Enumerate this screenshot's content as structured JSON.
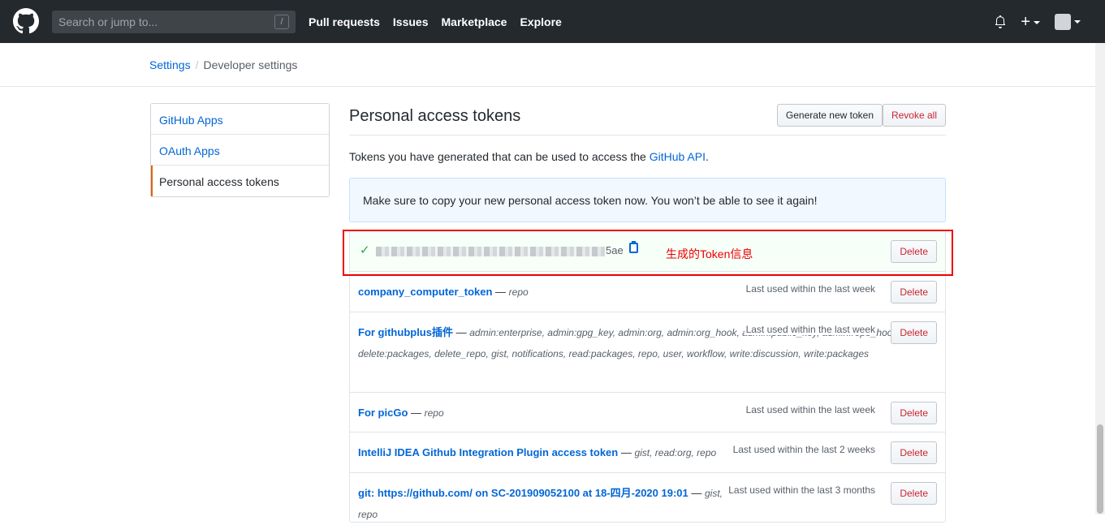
{
  "header": {
    "search_placeholder": "Search or jump to...",
    "search_shortcut": "/",
    "nav": [
      "Pull requests",
      "Issues",
      "Marketplace",
      "Explore"
    ],
    "plus": "+"
  },
  "breadcrumb": {
    "parent": "Settings",
    "separator": "/",
    "current": "Developer settings"
  },
  "sidebar": {
    "items": [
      {
        "label": "GitHub Apps"
      },
      {
        "label": "OAuth Apps"
      },
      {
        "label": "Personal access tokens",
        "active": true
      }
    ]
  },
  "main": {
    "title": "Personal access tokens",
    "generate_label": "Generate new token",
    "revoke_label": "Revoke all",
    "intro_prefix": "Tokens you have generated that can be used to access the ",
    "intro_link": "GitHub API",
    "intro_suffix": ".",
    "flash": "Make sure to copy your new personal access token now. You won’t be able to see it again!",
    "new_token": {
      "suffix": "5ae",
      "annotation": "生成的Token信息",
      "delete_label": "Delete"
    },
    "tokens": [
      {
        "name": "company_computer_token",
        "sep": " — ",
        "scopes": "repo",
        "used": "Last used within the last week",
        "delete_label": "Delete"
      },
      {
        "name": "For githubplus插件",
        "sep": " — ",
        "scopes": "admin:enterprise, admin:gpg_key, admin:org, admin:org_hook, admin:public_key, admin:repo_hook, delete:packages, delete_repo, gist, notifications, read:packages, repo, user, workflow, write:discussion, write:packages",
        "used": "Last used within the last week",
        "delete_label": "Delete"
      },
      {
        "name": "For picGo",
        "sep": " — ",
        "scopes": "repo",
        "used": "Last used within the last week",
        "delete_label": "Delete"
      },
      {
        "name": "IntelliJ IDEA Github Integration Plugin access token",
        "sep": " — ",
        "scopes": "gist, read:org, repo",
        "used": "Last used within the last 2 weeks",
        "delete_label": "Delete"
      },
      {
        "name": "git: https://github.com/ on SC-201909052100 at 18-四月-2020 19:01",
        "sep": " — ",
        "scopes": "gist, repo",
        "used": "Last used within the last 3 months",
        "delete_label": "Delete"
      }
    ]
  },
  "colors": {
    "header_bg": "#24292e",
    "link": "#0366d6",
    "danger": "#cb2431",
    "annotation": "#ee0000"
  }
}
